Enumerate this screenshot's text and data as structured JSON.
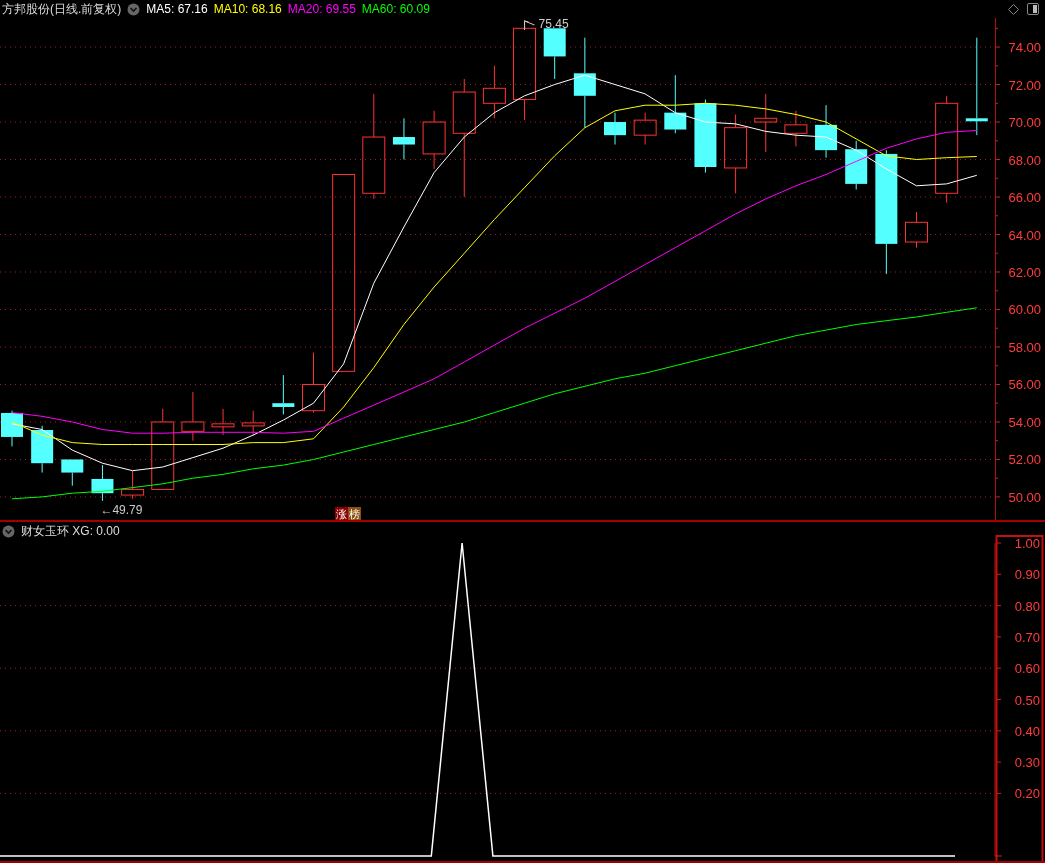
{
  "header": {
    "title": "方邦股份(日线.前复权)",
    "indicators": [
      {
        "value": ": 67.16"
      },
      {
        "value": ": 68.16"
      },
      {
        "value": ": 69.55"
      },
      {
        "value": ": 60.09"
      }
    ]
  },
  "main_chart": {
    "badge": [
      {
        "text": "涨",
        "color": "#8b0000"
      },
      {
        "text": "榜",
        "color": "#8b4f10"
      }
    ],
    "chart_data": {
      "type": "line",
      "grid": true,
      "ylim": [
        48.77,
        75.55
      ],
      "yticks": [
        {
          "value": 50,
          "label": "50.00"
        },
        {
          "value": 52,
          "label": "52.00"
        },
        {
          "value": 54,
          "label": "54.00"
        },
        {
          "value": 56,
          "label": "56.00"
        },
        {
          "value": 58,
          "label": "58.00"
        },
        {
          "value": 60,
          "label": "60.00"
        },
        {
          "value": 62,
          "label": "62.00"
        },
        {
          "value": 64,
          "label": "64.00"
        },
        {
          "value": 66,
          "label": "66.00"
        },
        {
          "value": 68,
          "label": "68.00"
        },
        {
          "value": 70,
          "label": "70.00"
        },
        {
          "value": 72,
          "label": "72.00"
        },
        {
          "value": 74,
          "label": "74.00"
        }
      ],
      "series": [
        {
          "name": "MA5",
          "color": "#ffffff",
          "values": [
            53.9,
            53.6,
            52.5,
            51.8,
            51.4,
            51.6,
            52.1,
            52.6,
            53.3,
            54.1,
            55.0,
            57.1,
            61.4,
            64.4,
            67.3,
            69.2,
            70.5,
            71.4,
            72.0,
            72.5,
            72.0,
            71.5,
            70.5,
            70.0,
            69.9,
            69.5,
            69.3,
            69.2,
            68.5,
            67.5,
            66.6,
            66.7,
            67.16
          ]
        },
        {
          "name": "MA10",
          "color": "#ffff00",
          "values": [
            54.0,
            53.3,
            52.9,
            52.8,
            52.8,
            52.8,
            52.8,
            52.8,
            52.9,
            52.9,
            53.1,
            54.8,
            56.9,
            59.2,
            61.2,
            63.0,
            64.8,
            66.5,
            68.2,
            69.7,
            70.6,
            70.9,
            70.9,
            71.0,
            70.9,
            70.7,
            70.4,
            70.0,
            69.1,
            68.2,
            68.0,
            68.1,
            68.16
          ]
        },
        {
          "name": "MA20",
          "color": "#ff00ff",
          "values": [
            54.5,
            54.3,
            54.0,
            53.6,
            53.4,
            53.4,
            53.45,
            53.45,
            53.45,
            53.4,
            53.5,
            54.2,
            54.9,
            55.6,
            56.3,
            57.2,
            58.1,
            59.0,
            59.8,
            60.6,
            61.5,
            62.4,
            63.3,
            64.2,
            65.1,
            65.9,
            66.6,
            67.2,
            67.9,
            68.6,
            69.1,
            69.45,
            69.55
          ]
        },
        {
          "name": "MA60",
          "color": "#00ff00",
          "values": [
            49.9,
            50.0,
            50.2,
            50.3,
            50.5,
            50.7,
            51.0,
            51.2,
            51.5,
            51.7,
            52.0,
            52.4,
            52.8,
            53.2,
            53.6,
            54.0,
            54.5,
            55.0,
            55.5,
            55.9,
            56.3,
            56.6,
            57.0,
            57.4,
            57.8,
            58.2,
            58.6,
            58.9,
            59.2,
            59.4,
            59.6,
            59.85,
            60.09
          ]
        }
      ],
      "annotations": [
        {
          "text": "←49.79"
        },
        {
          "text": "75.45"
        }
      ]
    }
  },
  "indicator_pane": {
    "title": "财女玉环",
    "value": ": 0.00",
    "chart_data": {
      "type": "line",
      "grid": true,
      "ylim": [
        0,
        1
      ],
      "yticks": [
        {
          "value": 0.2,
          "label": "0.20"
        },
        {
          "value": 0.3,
          "label": "0.30"
        },
        {
          "value": 0.4,
          "label": "0.40"
        },
        {
          "value": 0.5,
          "label": "0.50"
        },
        {
          "value": 0.6,
          "label": "0.60"
        },
        {
          "value": 0.7,
          "label": "0.70"
        },
        {
          "value": 0.8,
          "label": "0.80"
        },
        {
          "value": 0.9,
          "label": "0.90"
        },
        {
          "value": 1.0,
          "label": "1.00"
        }
      ],
      "series": [
        {
          "name": "XG",
          "color": "#ffffff",
          "values": [
            0,
            0,
            0,
            0,
            0,
            0,
            0,
            0,
            0,
            0,
            0,
            0,
            0,
            0,
            0,
            1,
            0,
            0,
            0,
            0,
            0,
            0,
            0,
            0,
            0,
            0,
            0,
            0,
            0,
            0,
            0,
            0
          ]
        }
      ]
    }
  }
}
